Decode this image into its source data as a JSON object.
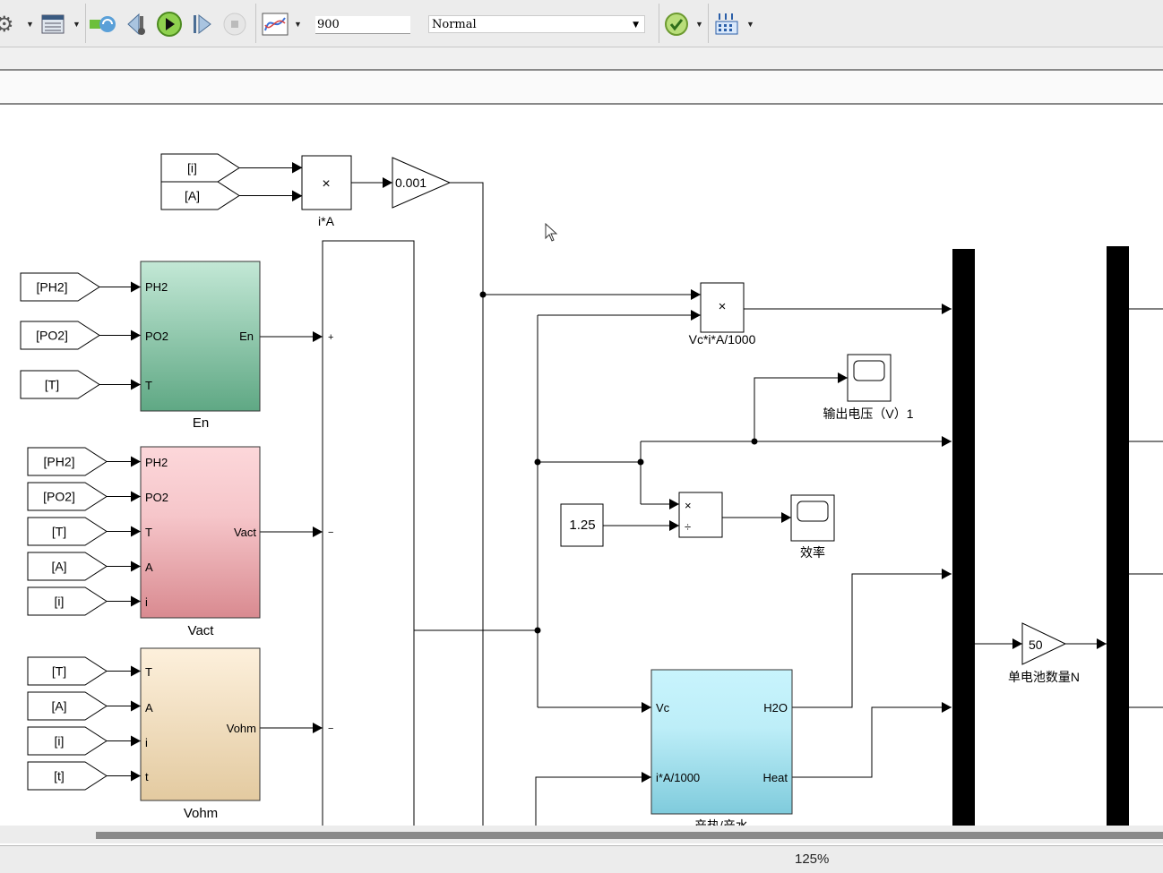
{
  "toolbar": {
    "icons": [
      "settings-gear-icon",
      "library-browser-icon",
      "update-diagram-icon",
      "step-back-icon",
      "run-icon",
      "step-forward-icon",
      "stop-icon",
      "data-inspector-icon",
      "model-advisor-check-icon",
      "build-icon"
    ],
    "stop_time": "900",
    "sim_mode": "Normal"
  },
  "diagram": {
    "tags": {
      "i": "[i]",
      "A": "[A]",
      "PH2": "[PH2]",
      "PO2": "[PO2]",
      "T": "[T]",
      "t": "[t]"
    },
    "product_symbol": "×",
    "divide_symbol": "÷",
    "iA_label": "i*A",
    "gain_0001": "0.001",
    "en": {
      "name": "En",
      "ports_in": [
        "PH2",
        "PO2",
        "T"
      ],
      "port_out": "En",
      "color": "#5fa884"
    },
    "vact": {
      "name": "Vact",
      "ports_in": [
        "PH2",
        "PO2",
        "T",
        "A",
        "i"
      ],
      "port_out": "Vact",
      "color": "#d98a90"
    },
    "vohm": {
      "name": "Vohm",
      "ports_in": [
        "T",
        "A",
        "i",
        "t"
      ],
      "port_out": "Vohm",
      "color": "#e3caa0"
    },
    "sum_signs": [
      "+",
      "−",
      "−"
    ],
    "power_label": "Vc*i*A/1000",
    "scope_voltage_label": "输出电压（V）1",
    "constant": "1.25",
    "scope_eff_label": "效率",
    "heat": {
      "name": "产热/产水",
      "ports_in": [
        "Vc",
        "i*A/1000"
      ],
      "ports_out": [
        "H2O",
        "Heat"
      ],
      "color": "#7fcbdc"
    },
    "gain_n": "50",
    "gain_n_label": "单电池数量N"
  },
  "status": {
    "zoom": "125%"
  }
}
